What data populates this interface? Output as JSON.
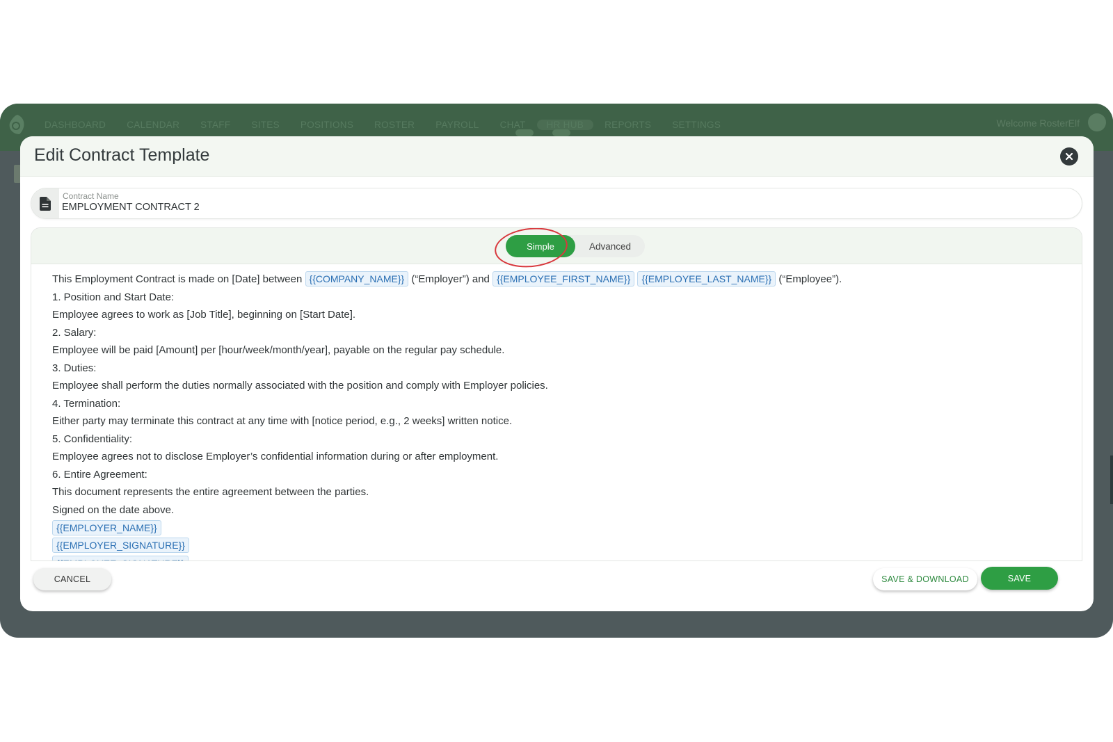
{
  "nav": {
    "items": [
      "DASHBOARD",
      "CALENDAR",
      "STAFF",
      "SITES",
      "POSITIONS",
      "ROSTER",
      "PAYROLL",
      "CHAT",
      "HR HUB",
      "REPORTS",
      "SETTINGS"
    ],
    "active": "HR HUB",
    "welcome": "Welcome RosterElf"
  },
  "modal": {
    "title": "Edit Contract Template",
    "close_icon": "close-circle-icon"
  },
  "contract_name": {
    "label": "Contract Name",
    "value": "EMPLOYMENT CONTRACT 2",
    "icon": "document-icon"
  },
  "mode_toggle": {
    "simple_label": "Simple",
    "advanced_label": "Advanced",
    "selected": "Simple"
  },
  "contract_body": {
    "intro": {
      "text1": "This Employment Contract is made on [Date] between ",
      "tag_company": "{{COMPANY_NAME}}",
      "text2": " (“Employer”) and ",
      "tag_first": "{{EMPLOYEE_FIRST_NAME}}",
      "tag_last": "{{EMPLOYEE_LAST_NAME}}",
      "text3": " (“Employee”)."
    },
    "lines": [
      "1. Position and Start Date:",
      "Employee agrees to work as [Job Title], beginning on [Start Date].",
      "2. Salary:",
      "Employee will be paid [Amount] per [hour/week/month/year], payable on the regular pay schedule.",
      "3. Duties:",
      "Employee shall perform the duties normally associated with the position and comply with Employer policies.",
      "4. Termination:",
      "Either party may terminate this contract at any time with [notice period, e.g., 2 weeks] written notice.",
      "5. Confidentiality:",
      "Employee agrees not to disclose Employer’s confidential information during or after employment.",
      "6. Entire Agreement:",
      "This document represents the entire agreement between the parties.",
      "Signed on the date above."
    ],
    "signature_tags": [
      "{{EMPLOYER_NAME}}",
      "{{EMPLOYER_SIGNATURE}}",
      "{{EMPLOYEE_SIGNATURE}}"
    ]
  },
  "footer": {
    "cancel_label": "CANCEL",
    "save_download_label": "SAVE & DOWNLOAD",
    "save_label": "SAVE"
  },
  "colors": {
    "accent_green": "#2e9e44",
    "tag_blue": "#2a6fb3",
    "annotation_red": "#d8383d"
  }
}
